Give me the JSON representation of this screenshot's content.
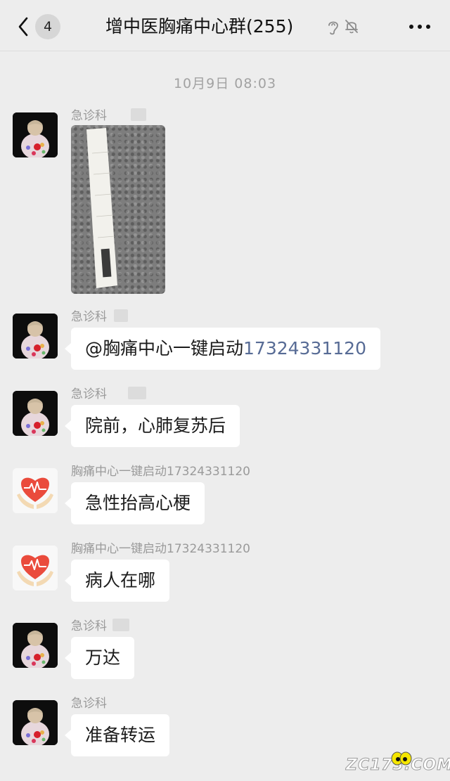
{
  "header": {
    "back_icon": "chevron-left-icon",
    "unread_count": "4",
    "title": "增中医胸痛中心群(255)",
    "ear_icon": "ear-icon",
    "mute_icon": "bell-muted-icon",
    "more_icon": "more-dots-icon"
  },
  "timestamp": "10月9日 08:03",
  "messages": [
    {
      "sender": "急诊科",
      "avatar": "portrait",
      "type": "image",
      "image_desc": "ecg-paper-photo"
    },
    {
      "sender": "急诊科",
      "avatar": "portrait",
      "type": "text",
      "mention": "@胸痛中心一键启动",
      "phone": "17324331120"
    },
    {
      "sender": "急诊科",
      "avatar": "portrait",
      "type": "text",
      "text": "院前，心肺复苏后"
    },
    {
      "sender": "胸痛中心一键启动17324331120",
      "avatar": "heart",
      "type": "text",
      "text": "急性抬高心梗"
    },
    {
      "sender": "胸痛中心一键启动17324331120",
      "avatar": "heart",
      "type": "text",
      "text": "病人在哪"
    },
    {
      "sender": "急诊科",
      "avatar": "portrait",
      "type": "text",
      "text": "万达"
    },
    {
      "sender": "急诊科",
      "avatar": "portrait",
      "type": "text",
      "text": "准备转运"
    }
  ],
  "watermark": "ZC173.COM",
  "colors": {
    "background": "#ededed",
    "bubble": "#ffffff",
    "link": "#576b95",
    "meta": "#9a9a9a"
  }
}
